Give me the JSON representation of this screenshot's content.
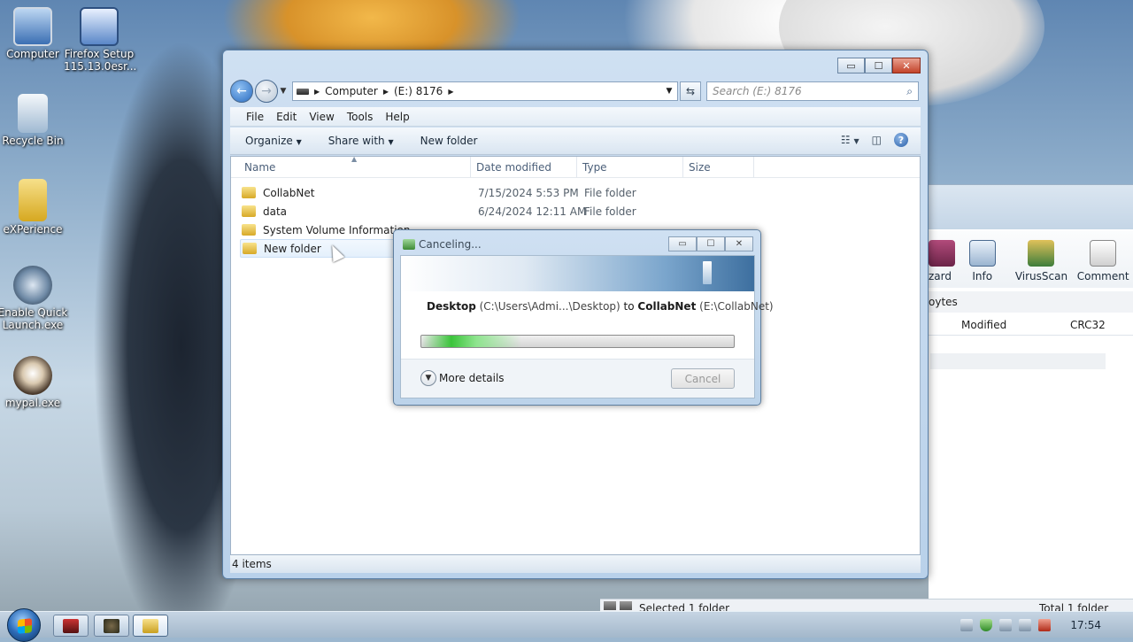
{
  "desktop": {
    "icons": [
      {
        "label": "Computer"
      },
      {
        "label": "Firefox Setup 115.13.0esr..."
      },
      {
        "label": "Recycle Bin"
      },
      {
        "label": "eXPerience"
      },
      {
        "label": "Enable Quick Launch.exe"
      },
      {
        "label": "mypal.exe"
      }
    ]
  },
  "explorer": {
    "window_controls": {
      "minimize": "▭",
      "maximize": "☐",
      "close": "✕"
    },
    "address": {
      "crumbs": [
        "Computer",
        "(E:) 8176"
      ]
    },
    "search_placeholder": "Search (E:) 8176",
    "menu": [
      "File",
      "Edit",
      "View",
      "Tools",
      "Help"
    ],
    "toolbar": {
      "organize": "Organize",
      "share_with": "Share with",
      "new_folder": "New folder"
    },
    "columns": {
      "name": "Name",
      "date": "Date modified",
      "type": "Type",
      "size": "Size"
    },
    "files": [
      {
        "name": "CollabNet",
        "date": "7/15/2024 5:53 PM",
        "type": "File folder"
      },
      {
        "name": "data",
        "date": "6/24/2024 12:11 AM",
        "type": "File folder"
      },
      {
        "name": "System Volume Information",
        "date": "",
        "type": ""
      },
      {
        "name": "New folder",
        "date": "",
        "type": ""
      }
    ],
    "status": "4 items"
  },
  "dialog": {
    "title": "Canceling...",
    "source_name": "Desktop",
    "source_path": "(C:\\Users\\Admi...\\Desktop)",
    "to_word": "to",
    "dest_name": "CollabNet",
    "dest_path": "(E:\\CollabNet)",
    "more_details": "More details",
    "cancel": "Cancel"
  },
  "bg_app": {
    "tools": [
      {
        "label": "zard",
        "icon": "wizard-icon"
      },
      {
        "label": "Info",
        "icon": "info-icon"
      },
      {
        "label": "VirusScan",
        "icon": "virusscan-icon"
      },
      {
        "label": "Comment",
        "icon": "comment-icon"
      }
    ],
    "info_text": "oytes",
    "columns": {
      "modified": "Modified",
      "crc": "CRC32"
    },
    "status_left": "Selected 1 folder",
    "status_right": "Total 1 folder"
  },
  "taskbar": {
    "clock": "17:54"
  }
}
